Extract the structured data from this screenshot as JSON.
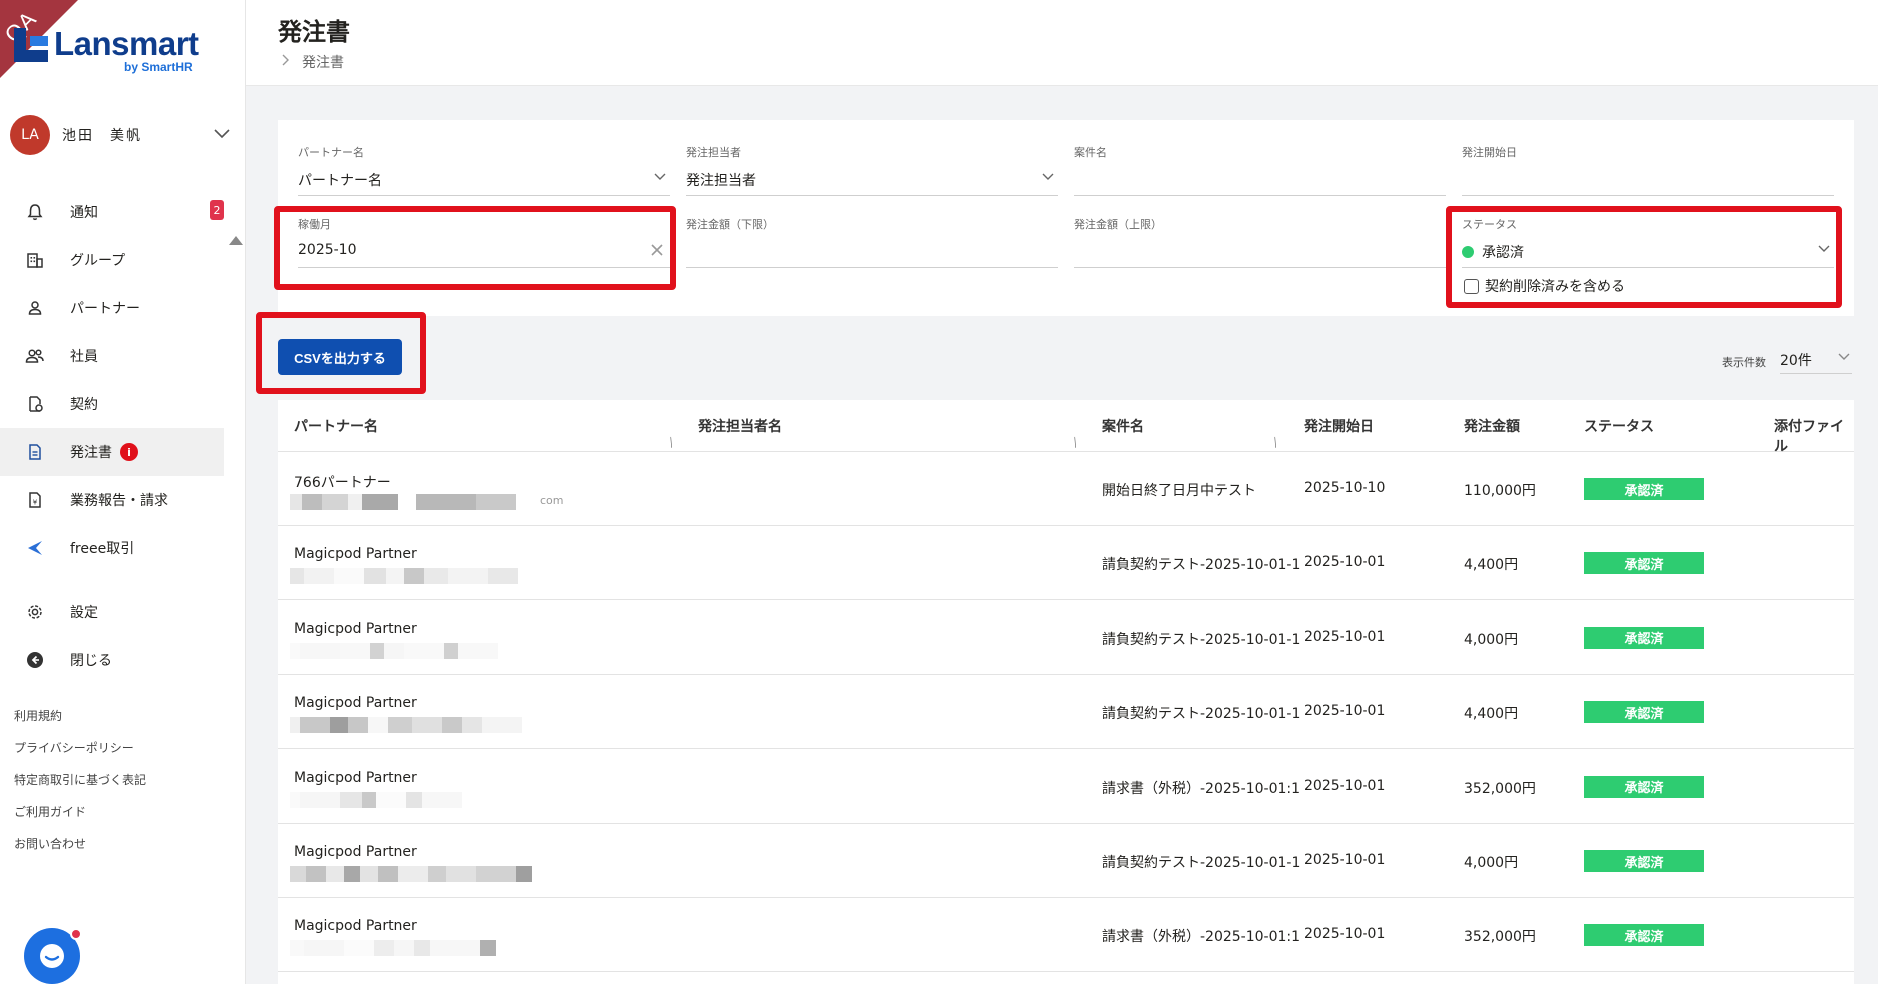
{
  "sidebar": {
    "qa_label": "QA",
    "logo_name": "Lansmart",
    "logo_sub": "by SmartHR",
    "user": {
      "initials": "LA",
      "name": "池田　美帆"
    },
    "nav": [
      {
        "label": "通知",
        "icon": "bell-icon",
        "badge": "2"
      },
      {
        "label": "グループ",
        "icon": "building-icon"
      },
      {
        "label": "パートナー",
        "icon": "person-icon"
      },
      {
        "label": "社員",
        "icon": "people-icon"
      },
      {
        "label": "契約",
        "icon": "contract-icon"
      },
      {
        "label": "発注書",
        "icon": "document-icon",
        "active": true,
        "info_badge": "i"
      },
      {
        "label": "業務報告・請求",
        "icon": "invoice-icon"
      },
      {
        "label": "freee取引",
        "icon": "freee-icon"
      },
      {
        "label": "設定",
        "icon": "gear-icon"
      },
      {
        "label": "閉じる",
        "icon": "collapse-icon"
      }
    ],
    "footer_links": [
      "利用規約",
      "プライバシーポリシー",
      "特定商取引に基づく表記",
      "ご利用ガイド",
      "お問い合わせ"
    ]
  },
  "header": {
    "title": "発注書",
    "breadcrumb": "発注書"
  },
  "filters": {
    "partner": {
      "label": "パートナー名",
      "placeholder": "パートナー名"
    },
    "manager": {
      "label": "発注担当者",
      "placeholder": "発注担当者"
    },
    "project": {
      "label": "案件名",
      "value": ""
    },
    "start_date": {
      "label": "発注開始日",
      "value": ""
    },
    "work_month": {
      "label": "稼働月",
      "value": "2025-10"
    },
    "amount_min": {
      "label": "発注金額（下限）",
      "value": ""
    },
    "amount_max": {
      "label": "発注金額（上限）",
      "value": ""
    },
    "status": {
      "label": "ステータス",
      "value": "承認済",
      "dot_color": "#2ecc71"
    },
    "include_deleted": {
      "label": "契約削除済みを含める",
      "checked": false
    }
  },
  "toolbar": {
    "csv_button": "CSVを出力する",
    "per_page_label": "表示件数",
    "per_page_value": "20件"
  },
  "table": {
    "columns": [
      "パートナー名",
      "発注担当者名",
      "案件名",
      "発注開始日",
      "発注金額",
      "ステータス",
      "添付ファイル"
    ],
    "rows": [
      {
        "partner": "766パートナー",
        "email_tail": "com",
        "project": "開始日終了日月中テスト",
        "start": "2025-10-10",
        "amount": "110,000円",
        "status": "承認済"
      },
      {
        "partner": "Magicpod Partner",
        "email_tail": "",
        "project": "請負契約テスト-2025-10-01-1",
        "start": "2025-10-01",
        "amount": "4,400円",
        "status": "承認済"
      },
      {
        "partner": "Magicpod Partner",
        "email_tail": "",
        "project": "請負契約テスト-2025-10-01-1",
        "start": "2025-10-01",
        "amount": "4,000円",
        "status": "承認済"
      },
      {
        "partner": "Magicpod Partner",
        "email_tail": "",
        "project": "請負契約テスト-2025-10-01-1",
        "start": "2025-10-01",
        "amount": "4,400円",
        "status": "承認済"
      },
      {
        "partner": "Magicpod Partner",
        "email_tail": "",
        "project": "請求書（外税）-2025-10-01:1",
        "start": "2025-10-01",
        "amount": "352,000円",
        "status": "承認済"
      },
      {
        "partner": "Magicpod Partner",
        "email_tail": "",
        "project": "請負契約テスト-2025-10-01-1",
        "start": "2025-10-01",
        "amount": "4,000円",
        "status": "承認済"
      },
      {
        "partner": "Magicpod Partner",
        "email_tail": "",
        "project": "請求書（外税）-2025-10-01:1",
        "start": "2025-10-01",
        "amount": "352,000円",
        "status": "承認済"
      }
    ]
  },
  "colors": {
    "accent": "#0f4fb0",
    "status_green": "#2ecc71",
    "highlight_red": "#e1111c",
    "badge_red": "#e0334c"
  }
}
